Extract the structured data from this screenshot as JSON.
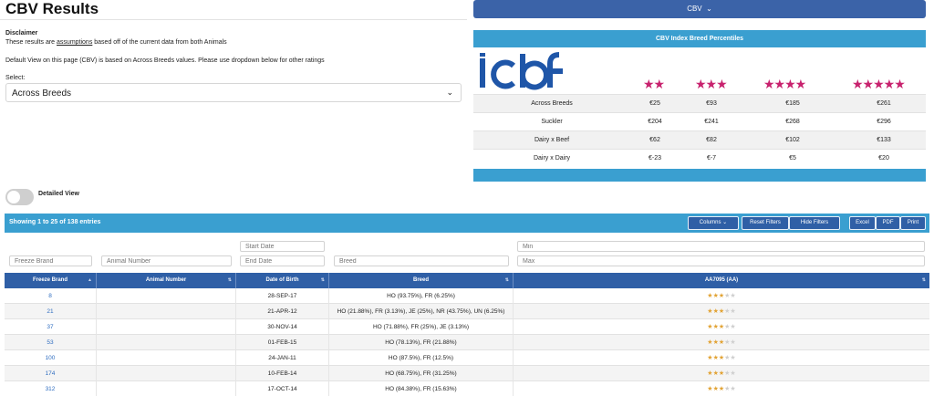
{
  "header": {
    "title": "CBV Results",
    "cbv_button": "CBV"
  },
  "disclaimer": {
    "heading": "Disclaimer",
    "text_before": "These results are ",
    "text_link": "assumptions",
    "text_after": " based off of the current data from both Animals",
    "default_note": "Default View on this page (CBV) is based on Across Breeds values. Please use dropdown below for other ratings"
  },
  "select": {
    "label": "Select:",
    "value": "Across Breeds"
  },
  "percentiles": {
    "title": "CBV Index Breed Percentiles",
    "logo_text": "icbf",
    "stars": [
      "★★",
      "★★★",
      "★★★★",
      "★★★★★"
    ],
    "rows": [
      {
        "label": "Across Breeds",
        "values": [
          "€25",
          "€93",
          "€185",
          "€261"
        ]
      },
      {
        "label": "Suckler",
        "values": [
          "€204",
          "€241",
          "€268",
          "€296"
        ]
      },
      {
        "label": "Dairy x Beef",
        "values": [
          "€62",
          "€82",
          "€102",
          "€133"
        ]
      },
      {
        "label": "Dairy x Dairy",
        "values": [
          "€-23",
          "€-7",
          "€5",
          "€20"
        ]
      }
    ]
  },
  "detailed_view": {
    "label": "Detailed View",
    "on": false
  },
  "table": {
    "info": "Showing 1 to 25 of 138 entries",
    "buttons": {
      "columns": "Columns",
      "reset": "Reset Filters",
      "hide": "Hide Filters",
      "excel": "Excel",
      "pdf": "PDF",
      "print": "Print"
    },
    "filters": {
      "freeze_brand": "Freeze Brand",
      "animal_number": "Animal Number",
      "start_date": "Start Date",
      "end_date": "End Date",
      "breed": "Breed",
      "min": "Min",
      "max": "Max"
    },
    "columns": [
      "Freeze Brand",
      "Animal Number",
      "Date of Birth",
      "Breed",
      "AA7095 (AA)"
    ],
    "rows": [
      {
        "brand": "8",
        "animal": "",
        "dob": "28-SEP-17",
        "breed": "HO (93.75%), FR (6.25%)",
        "stars": 3
      },
      {
        "brand": "21",
        "animal": "",
        "dob": "21-APR-12",
        "breed": "HO (21.88%), FR (3.13%), JE (25%), NR (43.75%), UN (6.25%)",
        "stars": 3
      },
      {
        "brand": "37",
        "animal": "",
        "dob": "30-NOV-14",
        "breed": "HO (71.88%), FR (25%), JE (3.13%)",
        "stars": 3
      },
      {
        "brand": "53",
        "animal": "",
        "dob": "01-FEB-15",
        "breed": "HO (78.13%), FR (21.88%)",
        "stars": 3
      },
      {
        "brand": "100",
        "animal": "",
        "dob": "24-JAN-11",
        "breed": "HO (87.5%), FR (12.5%)",
        "stars": 3
      },
      {
        "brand": "174",
        "animal": "",
        "dob": "10-FEB-14",
        "breed": "HO (68.75%), FR (31.25%)",
        "stars": 3
      },
      {
        "brand": "312",
        "animal": "",
        "dob": "17-OCT-14",
        "breed": "HO (84.38%), FR (15.63%)",
        "stars": 3
      }
    ],
    "max_stars": 5
  },
  "colors": {
    "primary": "#2f5fa6",
    "accent": "#3a9fd0",
    "star_pink": "#c8226e",
    "star_gold": "#e2a334",
    "logo_blue": "#1f56a8"
  }
}
